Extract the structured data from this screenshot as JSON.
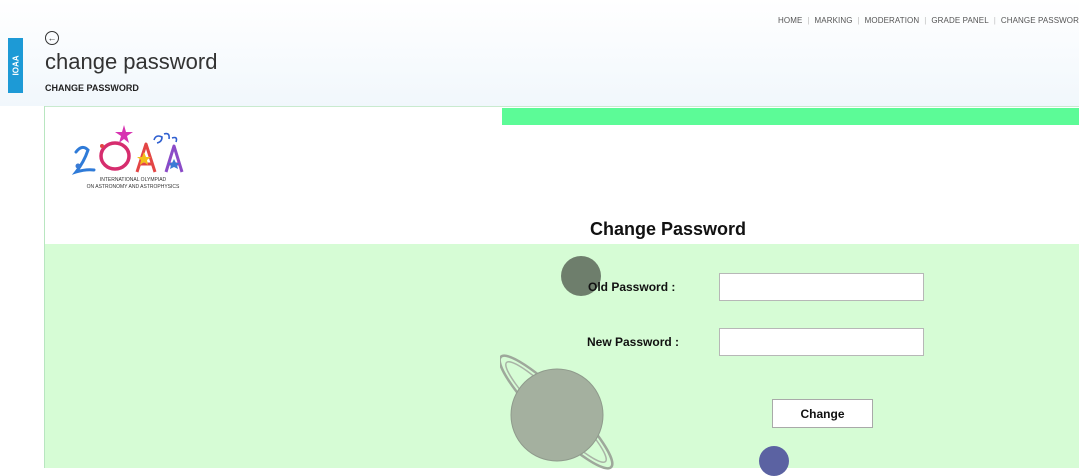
{
  "side_tab": {
    "label": "IOAA"
  },
  "nav": {
    "items": [
      "HOME",
      "MARKING",
      "MODERATION",
      "GRADE PANEL",
      "CHANGE PASSWOR"
    ]
  },
  "header": {
    "back_icon": "arrow-left-circle-icon",
    "title": "change password",
    "breadcrumb": "CHANGE PASSWORD"
  },
  "logo": {
    "text_line1": "INTERNATIONAL OLYMPIAD",
    "text_line2": "ON ASTRONOMY AND ASTROPHYSICS"
  },
  "form": {
    "title": "Change Password",
    "old_password_label": "Old Password :",
    "new_password_label": "New Password :",
    "old_password_value": "",
    "new_password_value": "",
    "submit_label": "Change"
  },
  "colors": {
    "accent_green": "#5cfb97",
    "panel_green": "#d6fcd5",
    "side_tab_blue": "#1d9ad6"
  }
}
